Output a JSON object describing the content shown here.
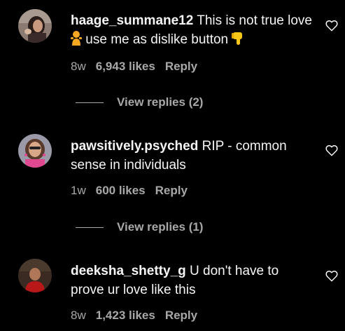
{
  "comments": [
    {
      "username": "haage_summane12",
      "text_part1": " This is not true love",
      "text_part2": " use me as dislike button",
      "time": "8w",
      "likes": "6,943 likes",
      "reply": "Reply",
      "view_replies": "View replies (2)",
      "avatar_icon": "avatar-icon",
      "like_icon": "heart-outline-icon"
    },
    {
      "username": "pawsitively.psyched",
      "text": " RIP - common sense in individuals",
      "time": "1w",
      "likes": "600 likes",
      "reply": "Reply",
      "view_replies": "View replies (1)",
      "avatar_icon": "avatar-icon",
      "like_icon": "heart-outline-icon"
    },
    {
      "username": "deeksha_shetty_g",
      "text": " U don't have to prove ur love like this",
      "time": "8w",
      "likes": "1,423 likes",
      "reply": "Reply",
      "avatar_icon": "avatar-icon",
      "like_icon": "heart-outline-icon"
    }
  ],
  "colors": {
    "background": "#000000",
    "primary_text": "#f5f5f5",
    "secondary_text": "#a8a8a8"
  }
}
